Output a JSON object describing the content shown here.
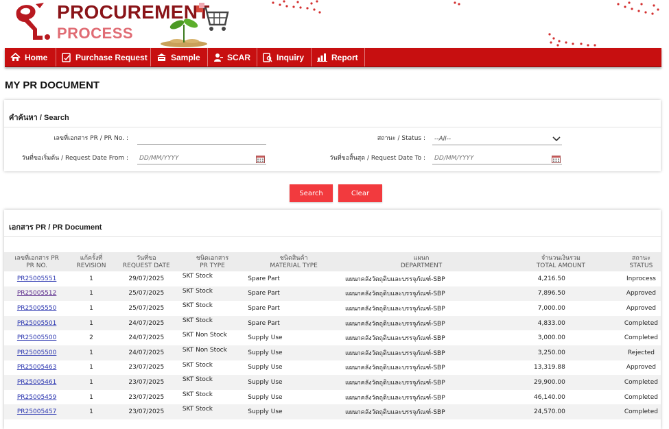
{
  "header": {
    "brand_line1": "PROCUREMENT",
    "brand_line2": "PROCESS",
    "logo_glyph": "ส.",
    "colors": {
      "primary_red": "#c70f10",
      "dark_red": "#8a1418",
      "light_red": "#e06c74"
    }
  },
  "nav": [
    {
      "label": "Home",
      "icon": "home-icon"
    },
    {
      "label": "Purchase Request",
      "icon": "document-edit-icon"
    },
    {
      "label": "Sample",
      "icon": "box-icon"
    },
    {
      "label": "SCAR",
      "icon": "user-icon"
    },
    {
      "label": "Inquiry",
      "icon": "inquiry-icon"
    },
    {
      "label": "Report",
      "icon": "chart-icon"
    }
  ],
  "page": {
    "title": "MY PR DOCUMENT"
  },
  "search": {
    "heading": "คำค้นหา / Search",
    "pr_no_label": "เลขที่เอกสาร PR / PR No. :",
    "pr_no_value": "",
    "status_label": "สถานะ / Status :",
    "status_selected": "--All--",
    "date_from_label": "วันที่ขอเริ่มต้น / Request Date From :",
    "date_from_placeholder": "DD/MM/YYYY",
    "date_to_label": "วันที่ขอสิ้นสุด / Request Date To :",
    "date_to_placeholder": "DD/MM/YYYY",
    "search_button": "Search",
    "clear_button": "Clear"
  },
  "documents": {
    "heading": "เอกสาร PR / PR Document",
    "columns": [
      {
        "th": "เลขที่เอกสาร PR",
        "en": "PR NO."
      },
      {
        "th": "แก้ครั้งที่",
        "en": "REVISION"
      },
      {
        "th": "วันที่ขอ",
        "en": "REQUEST DATE"
      },
      {
        "th": "ชนิดเอกสาร",
        "en": "PR TYPE"
      },
      {
        "th": "ชนิดสินค้า",
        "en": "MATERIAL TYPE"
      },
      {
        "th": "แผนก",
        "en": "DEPARTMENT"
      },
      {
        "th": "จำนวนเงินรวม",
        "en": "TOTAL AMOUNT"
      },
      {
        "th": "สถานะ",
        "en": "STATUS"
      }
    ],
    "rows": [
      {
        "pr_no": "PR25005551",
        "revision": "1",
        "date": "29/07/2025",
        "pr_type": "SKT Stock",
        "material": "Spare Part",
        "dept": "แผนกคลังวัตถุดิบและบรรจุภัณฑ์-SBP",
        "amount": "4,216.50",
        "status": "Inprocess"
      },
      {
        "pr_no": "PR25005512",
        "revision": "1",
        "date": "25/07/2025",
        "pr_type": "SKT Stock",
        "material": "Spare Part",
        "dept": "แผนกคลังวัตถุดิบและบรรจุภัณฑ์-SBP",
        "amount": "7,896.50",
        "status": "Approved"
      },
      {
        "pr_no": "PR25005550",
        "revision": "1",
        "date": "25/07/2025",
        "pr_type": "SKT Stock",
        "material": "Spare Part",
        "dept": "แผนกคลังวัตถุดิบและบรรจุภัณฑ์-SBP",
        "amount": "7,000.00",
        "status": "Approved"
      },
      {
        "pr_no": "PR25005501",
        "revision": "1",
        "date": "24/07/2025",
        "pr_type": "SKT Stock",
        "material": "Spare Part",
        "dept": "แผนกคลังวัตถุดิบและบรรจุภัณฑ์-SBP",
        "amount": "4,833.00",
        "status": "Completed"
      },
      {
        "pr_no": "PR25005500",
        "revision": "2",
        "date": "24/07/2025",
        "pr_type": "SKT Non Stock",
        "material": "Supply Use",
        "dept": "แผนกคลังวัตถุดิบและบรรจุภัณฑ์-SBP",
        "amount": "3,000.00",
        "status": "Completed"
      },
      {
        "pr_no": "PR25005500",
        "revision": "1",
        "date": "24/07/2025",
        "pr_type": "SKT Non Stock",
        "material": "Supply Use",
        "dept": "แผนกคลังวัตถุดิบและบรรจุภัณฑ์-SBP",
        "amount": "3,250.00",
        "status": "Rejected"
      },
      {
        "pr_no": "PR25005463",
        "revision": "1",
        "date": "23/07/2025",
        "pr_type": "SKT Stock",
        "material": "Supply Use",
        "dept": "แผนกคลังวัตถุดิบและบรรจุภัณฑ์-SBP",
        "amount": "13,319.88",
        "status": "Approved"
      },
      {
        "pr_no": "PR25005461",
        "revision": "1",
        "date": "23/07/2025",
        "pr_type": "SKT Stock",
        "material": "Supply Use",
        "dept": "แผนกคลังวัตถุดิบและบรรจุภัณฑ์-SBP",
        "amount": "29,900.00",
        "status": "Completed"
      },
      {
        "pr_no": "PR25005459",
        "revision": "1",
        "date": "23/07/2025",
        "pr_type": "SKT Stock",
        "material": "Supply Use",
        "dept": "แผนกคลังวัตถุดิบและบรรจุภัณฑ์-SBP",
        "amount": "46,140.00",
        "status": "Completed"
      },
      {
        "pr_no": "PR25005457",
        "revision": "1",
        "date": "23/07/2025",
        "pr_type": "SKT Stock",
        "material": "Supply Use",
        "dept": "แผนกคลังวัตถุดิบและบรรจุภัณฑ์-SBP",
        "amount": "24,570.00",
        "status": "Completed"
      }
    ]
  }
}
